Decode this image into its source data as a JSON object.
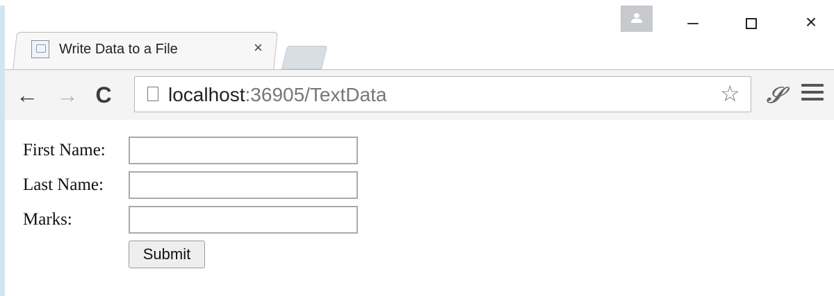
{
  "browser": {
    "tab_title": "Write Data to a File",
    "tab_close": "×",
    "url_host": "localhost",
    "url_rest": ":36905/TextData"
  },
  "window_controls": {
    "minimize": "–",
    "close": "×"
  },
  "icons": {
    "back": "back-arrow-icon",
    "forward": "forward-arrow-icon",
    "reload": "reload-icon",
    "star": "star-icon",
    "menu": "menu-icon"
  },
  "form": {
    "first_name_label": "First Name:",
    "last_name_label": "Last Name:",
    "marks_label": "Marks:",
    "first_name_value": "",
    "last_name_value": "",
    "marks_value": "",
    "submit_label": "Submit"
  }
}
